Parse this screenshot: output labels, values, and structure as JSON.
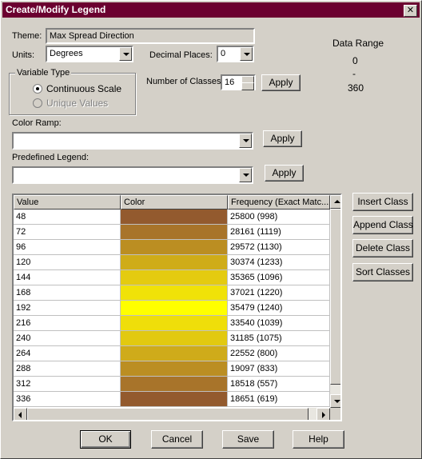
{
  "window": {
    "title": "Create/Modify Legend",
    "close_glyph": "✕"
  },
  "theme": {
    "label": "Theme:",
    "value": "Max Spread Direction"
  },
  "units": {
    "label": "Units:",
    "value": "Degrees"
  },
  "decimal": {
    "label": "Decimal Places:",
    "value": "0"
  },
  "data_range": {
    "label": "Data Range",
    "min": "0",
    "sep": "-",
    "max": "360"
  },
  "variable_type": {
    "label": "Variable Type",
    "continuous": "Continuous Scale",
    "unique": "Unique Values"
  },
  "num_classes": {
    "label": "Number of Classes:",
    "value": "16",
    "apply": "Apply"
  },
  "color_ramp": {
    "label": "Color Ramp:",
    "value": "",
    "apply": "Apply"
  },
  "predefined": {
    "label": "Predefined Legend:",
    "value": "",
    "apply": "Apply"
  },
  "table": {
    "columns": [
      "Value",
      "Color",
      "Frequency (Exact Matc..."
    ],
    "rows": [
      {
        "value": "48",
        "color": "#935a2e",
        "freq": "25800 (998)"
      },
      {
        "value": "72",
        "color": "#a8742a",
        "freq": "28161 (1119)"
      },
      {
        "value": "96",
        "color": "#bb8e22",
        "freq": "29572 (1130)"
      },
      {
        "value": "120",
        "color": "#cfac18",
        "freq": "30374 (1233)"
      },
      {
        "value": "144",
        "color": "#e4cb10",
        "freq": "35365 (1096)"
      },
      {
        "value": "168",
        "color": "#f0e208",
        "freq": "37021 (1220)"
      },
      {
        "value": "192",
        "color": "#ffff00",
        "freq": "35479 (1240)"
      },
      {
        "value": "216",
        "color": "#efde0a",
        "freq": "33540 (1039)"
      },
      {
        "value": "240",
        "color": "#e2c910",
        "freq": "31185 (1075)"
      },
      {
        "value": "264",
        "color": "#cfab1a",
        "freq": "22552 (800)"
      },
      {
        "value": "288",
        "color": "#bb8e22",
        "freq": "19097 (833)"
      },
      {
        "value": "312",
        "color": "#a8742a",
        "freq": "18518 (557)"
      },
      {
        "value": "336",
        "color": "#935a2e",
        "freq": "18651 (619)"
      }
    ]
  },
  "side_buttons": {
    "insert": "Insert Class",
    "append": "Append Class",
    "delete": "Delete Class",
    "sort": "Sort Classes"
  },
  "bottom_buttons": {
    "ok": "OK",
    "cancel": "Cancel",
    "save": "Save",
    "help": "Help"
  }
}
